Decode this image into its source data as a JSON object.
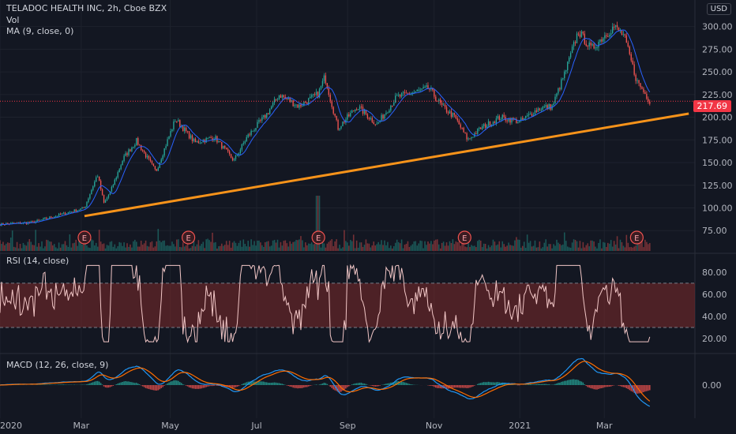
{
  "header": {
    "title": "TELADOC HEALTH INC, 2h, Cboe BZX",
    "vol_label": "Vol",
    "ma_label": "MA (9, close, 0)",
    "currency": "USD"
  },
  "rsi_panel": {
    "label": "RSI (14, close)"
  },
  "macd_panel": {
    "label": "MACD (12, 26, close, 9)"
  },
  "current_price": "217.69",
  "colors": {
    "background": "#131722",
    "up": "#26a69a",
    "down": "#ef5350",
    "ma": "#2962ff",
    "trendline": "#f7931a",
    "rsi_band": "#7e2a2a",
    "rsi_line": "#f1c6c6",
    "macd": "#2196f3",
    "signal": "#ff6d00",
    "price_tag": "#f23645"
  },
  "chart_data": [
    {
      "type": "candlestick",
      "title": "TELADOC HEALTH INC, 2h, Cboe BZX",
      "x_ticks": [
        "2020",
        "Mar",
        "May",
        "Jul",
        "Sep",
        "Nov",
        "2021",
        "Mar"
      ],
      "y_ticks": [
        "300.00",
        "275.00",
        "250.00",
        "225.00",
        "200.00",
        "175.00",
        "150.00",
        "125.00",
        "100.00",
        "75.00"
      ],
      "ylim": [
        63,
        311
      ],
      "price_path": [
        {
          "t": 0,
          "v": 82
        },
        {
          "t": 0.05,
          "v": 84
        },
        {
          "t": 0.09,
          "v": 92
        },
        {
          "t": 0.13,
          "v": 100
        },
        {
          "t": 0.15,
          "v": 137
        },
        {
          "t": 0.16,
          "v": 105
        },
        {
          "t": 0.17,
          "v": 118
        },
        {
          "t": 0.19,
          "v": 155
        },
        {
          "t": 0.21,
          "v": 174
        },
        {
          "t": 0.24,
          "v": 140
        },
        {
          "t": 0.27,
          "v": 198
        },
        {
          "t": 0.3,
          "v": 172
        },
        {
          "t": 0.33,
          "v": 178
        },
        {
          "t": 0.36,
          "v": 152
        },
        {
          "t": 0.38,
          "v": 178
        },
        {
          "t": 0.41,
          "v": 203
        },
        {
          "t": 0.43,
          "v": 225
        },
        {
          "t": 0.46,
          "v": 212
        },
        {
          "t": 0.49,
          "v": 226
        },
        {
          "t": 0.5,
          "v": 245
        },
        {
          "t": 0.52,
          "v": 188
        },
        {
          "t": 0.55,
          "v": 212
        },
        {
          "t": 0.58,
          "v": 192
        },
        {
          "t": 0.61,
          "v": 222
        },
        {
          "t": 0.64,
          "v": 228
        },
        {
          "t": 0.66,
          "v": 232
        },
        {
          "t": 0.68,
          "v": 212
        },
        {
          "t": 0.7,
          "v": 200
        },
        {
          "t": 0.72,
          "v": 175
        },
        {
          "t": 0.74,
          "v": 188
        },
        {
          "t": 0.77,
          "v": 200
        },
        {
          "t": 0.8,
          "v": 195
        },
        {
          "t": 0.83,
          "v": 210
        },
        {
          "t": 0.85,
          "v": 212
        },
        {
          "t": 0.87,
          "v": 250
        },
        {
          "t": 0.89,
          "v": 295
        },
        {
          "t": 0.91,
          "v": 275
        },
        {
          "t": 0.93,
          "v": 290
        },
        {
          "t": 0.945,
          "v": 300
        },
        {
          "t": 0.96,
          "v": 290
        },
        {
          "t": 0.98,
          "v": 240
        },
        {
          "t": 1,
          "v": 218
        }
      ],
      "moving_average": {
        "name": "MA (9, close, 0)",
        "period": 9
      },
      "volume": {
        "name": "Vol"
      },
      "trendline": {
        "start": {
          "t": 0.13,
          "v": 91
        },
        "end": {
          "t": 1.06,
          "v": 204
        }
      },
      "last_price": 217.69,
      "earnings_markers": {
        "label": "E",
        "t": [
          0.13,
          0.29,
          0.49,
          0.715,
          0.98
        ]
      }
    },
    {
      "type": "line",
      "name": "RSI (14, close)",
      "y_ticks": [
        "80.00",
        "60.00",
        "40.00",
        "20.00"
      ],
      "ylim": [
        10,
        92
      ],
      "band": [
        30,
        70
      ],
      "points": 420
    },
    {
      "type": "line",
      "name": "MACD (12, 26, close, 9)",
      "y_ticks": [
        "0.00"
      ],
      "series": [
        {
          "name": "MACD"
        },
        {
          "name": "Signal"
        }
      ]
    }
  ]
}
